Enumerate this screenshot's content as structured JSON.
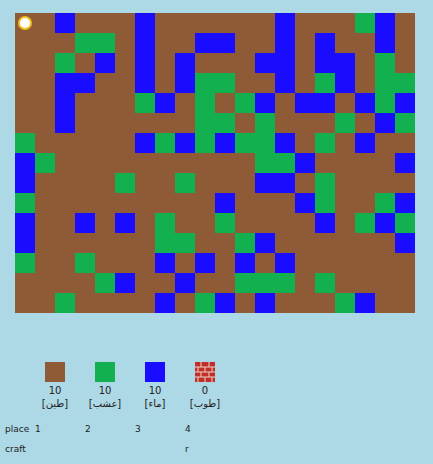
{
  "grid": [
    "ddwdddwddddddwdddgwd",
    "dddggdwddwwddwdwddwd",
    "ddgdwdwdwdddwwdwwdgd",
    "ddwwddwdwggddwdgwdgg",
    "ddwdddgwdgdgwdwwdwgw",
    "ddwddddddggdgdddgdwg",
    "gdddddwgwgwggwdgdwdd",
    "wgddddddddddggwddddw",
    "wddddgddgdddwwdgdddd",
    "gdddddddddwdddwgddgw",
    "wddwdwdgddgddddwdgwg",
    "wddddddggddgwddddddw",
    "gddgdddwdwdwdwdddddd",
    "ddddgwddwddgggdgdddd",
    "ddgddddwdgwdwdddgwdd"
  ],
  "agent": {
    "row": 0,
    "col": 0
  },
  "inventory": [
    {
      "count": "10",
      "label": "[طين]",
      "color": "#8f5a36",
      "kind": "swatch"
    },
    {
      "count": "10",
      "label": "[عشب]",
      "color": "#12b04e",
      "kind": "swatch"
    },
    {
      "count": "10",
      "label": "[ماء]",
      "color": "#1a0cff",
      "kind": "swatch"
    },
    {
      "count": "0",
      "label": "[طوب]",
      "color": "#c0302a",
      "kind": "brick"
    }
  ],
  "place": {
    "label": "place",
    "keys": [
      "1",
      "2",
      "3",
      "4"
    ]
  },
  "craft": {
    "label": "craft",
    "keys": [
      "",
      "",
      "",
      "r"
    ]
  }
}
